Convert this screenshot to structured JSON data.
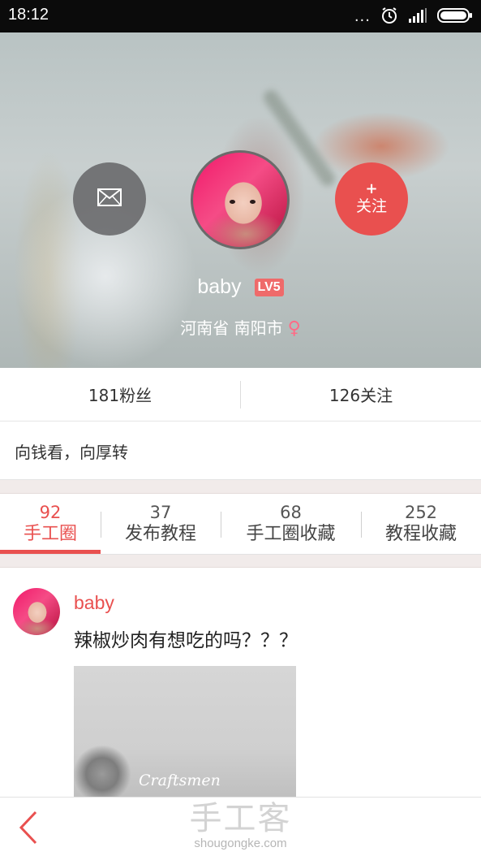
{
  "status_bar": {
    "time": "18:12",
    "dots": "..."
  },
  "profile": {
    "name": "baby",
    "level": "LV5",
    "location": "河南省 南阳市",
    "gender_symbol": "♀",
    "follow_plus": "+",
    "follow_label": "关注",
    "accent_color": "#e9504f"
  },
  "stats": {
    "fans": "181粉丝",
    "following": "126关注"
  },
  "signature": "向钱看，向厚转",
  "tabs": [
    {
      "count": "92",
      "label": "手工圈"
    },
    {
      "count": "37",
      "label": "发布教程"
    },
    {
      "count": "68",
      "label": "手工圈收藏"
    },
    {
      "count": "252",
      "label": "教程收藏"
    }
  ],
  "post": {
    "user": "baby",
    "text": "辣椒炒肉有想吃的吗？？？",
    "image_watermark": "Craftsmen"
  },
  "bottom_bar": {
    "brand_cn": "手工客",
    "brand_url": "shougongke.com"
  },
  "icons": [
    "envelope-icon",
    "alarm-icon",
    "signal-icon",
    "battery-icon",
    "back-chevron-icon"
  ]
}
